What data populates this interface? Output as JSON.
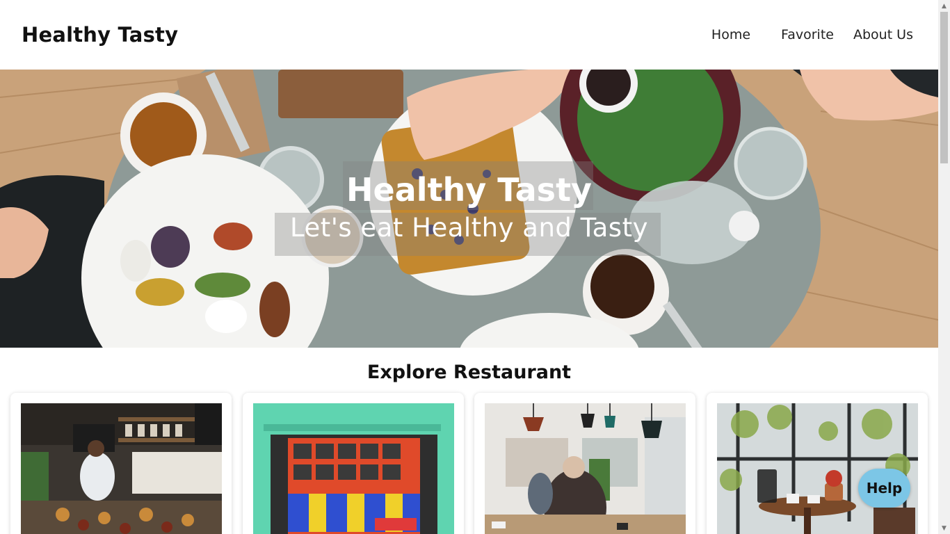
{
  "header": {
    "brand": "Healthy Tasty",
    "nav": [
      {
        "label": "Home"
      },
      {
        "label": "Favorite"
      },
      {
        "label": "About Us"
      }
    ]
  },
  "hero": {
    "title": "Healthy Tasty",
    "subtitle": "Let's eat Healthy and Tasty"
  },
  "explore": {
    "title": "Explore Restaurant"
  },
  "help": {
    "label": "Help"
  },
  "colors": {
    "help_button": "#7cc6e6",
    "background": "#ffffff"
  }
}
